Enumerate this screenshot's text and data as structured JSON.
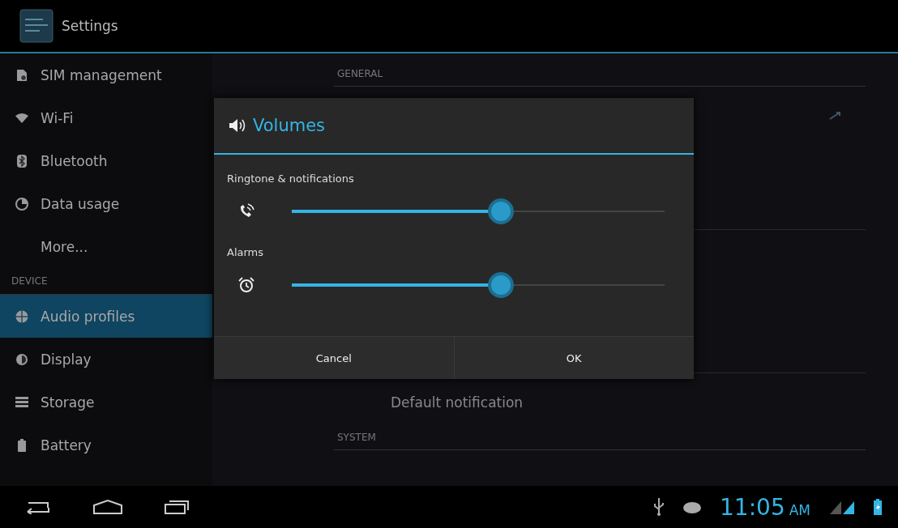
{
  "action_bar": {
    "title": "Settings"
  },
  "sidebar": {
    "items": [
      {
        "label": "SIM management",
        "kind": "item",
        "selected": false
      },
      {
        "label": "Wi-Fi",
        "kind": "item",
        "selected": false
      },
      {
        "label": "Bluetooth",
        "kind": "item",
        "selected": false
      },
      {
        "label": "Data usage",
        "kind": "item",
        "selected": false
      },
      {
        "label": "More...",
        "kind": "item",
        "selected": false
      },
      {
        "label": "DEVICE",
        "kind": "header"
      },
      {
        "label": "Audio profiles",
        "kind": "item",
        "selected": true
      },
      {
        "label": "Display",
        "kind": "item",
        "selected": false
      },
      {
        "label": "Storage",
        "kind": "item",
        "selected": false
      },
      {
        "label": "Battery",
        "kind": "item",
        "selected": false
      }
    ]
  },
  "content": {
    "general_header": "GENERAL",
    "default_notification": "Default notification",
    "system_header": "SYSTEM"
  },
  "dialog": {
    "title": "Volumes",
    "sliders": [
      {
        "label": "Ringtone & notifications",
        "level": 0.56
      },
      {
        "label": "Alarms",
        "level": 0.56
      }
    ],
    "buttons": [
      "Cancel",
      "OK"
    ]
  },
  "status_bar": {
    "time": "11:05",
    "meridiem": "AM"
  }
}
